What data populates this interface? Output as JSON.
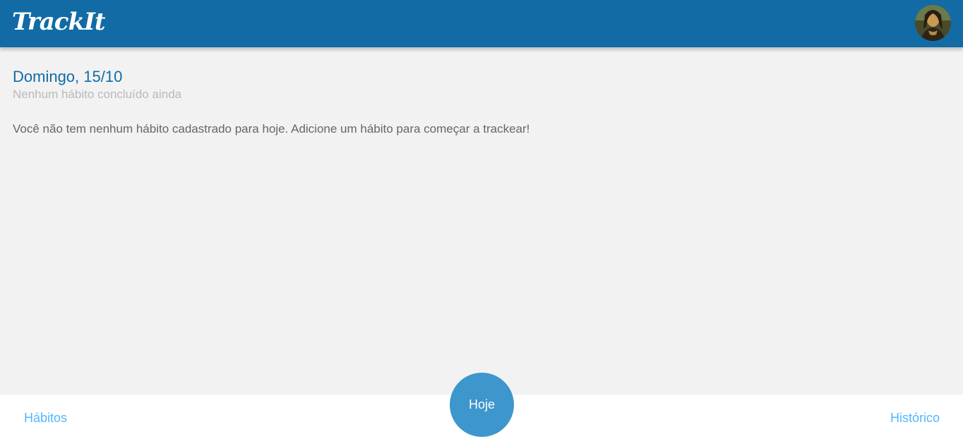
{
  "header": {
    "logo_text": "TrackIt",
    "avatar_icon": "user-avatar-portrait"
  },
  "today": {
    "date_title": "Domingo, 15/10",
    "progress_text": "Nenhum hábito concluído ainda",
    "empty_message": "Você não tem nenhum hábito cadastrado para hoje. Adicione um hábito para começar a trackear!"
  },
  "footer": {
    "habits_label": "Hábitos",
    "today_label": "Hoje",
    "history_label": "Histórico"
  },
  "colors": {
    "header_bg": "#126ba5",
    "accent": "#52b6ff",
    "today_button": "#3d96cc",
    "title": "#126ba5",
    "muted": "#bababa"
  }
}
